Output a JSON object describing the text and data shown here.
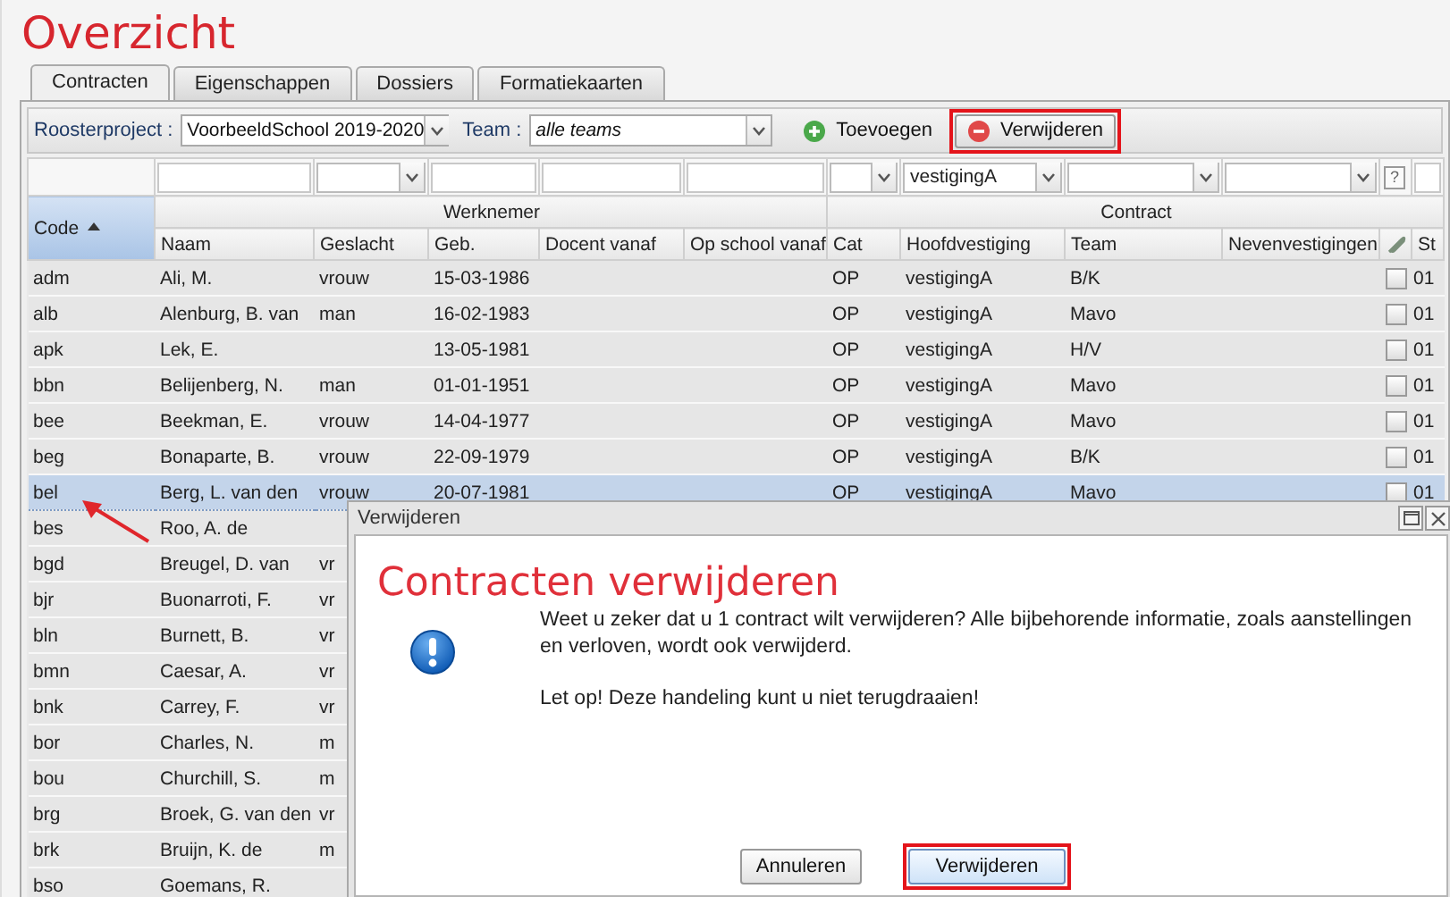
{
  "title": "Overzicht",
  "tabs": [
    {
      "label": "Contracten",
      "selected": true
    },
    {
      "label": "Eigenschappen",
      "selected": false
    },
    {
      "label": "Dossiers",
      "selected": false
    },
    {
      "label": "Formatiekaarten",
      "selected": false
    }
  ],
  "toolbar": {
    "project_label": "Roosterproject :",
    "project_value": "VoorbeeldSchool 2019-2020",
    "team_label": "Team :",
    "team_value": "alle teams",
    "add_button": "Toevoegen",
    "delete_button": {
      "label": "Verwijderen",
      "highlighted": true
    }
  },
  "table": {
    "code_column": {
      "label": "Code",
      "sorted": true
    },
    "groups": [
      {
        "label": "Werknemer",
        "columns": [
          {
            "label": "Naam",
            "filter": {
              "kind": "text"
            }
          },
          {
            "label": "Geslacht",
            "filter": {
              "kind": "select"
            }
          },
          {
            "label": "Geb.",
            "filter": {
              "kind": "text"
            }
          },
          {
            "label": "Docent vanaf",
            "filter": {
              "kind": "text"
            }
          },
          {
            "label": "Op school vanaf",
            "filter": {
              "kind": "text"
            }
          }
        ]
      },
      {
        "label": "Contract",
        "columns": [
          {
            "label": "Cat",
            "filter": {
              "kind": "select"
            }
          },
          {
            "label": "Hoofdvestiging",
            "filter": {
              "kind": "select",
              "value": "vestigingA"
            }
          },
          {
            "label": "Team",
            "filter": {
              "kind": "select"
            }
          },
          {
            "label": "Nevenvestigingen",
            "filter": {
              "kind": "select"
            }
          },
          {
            "kind": "attachment",
            "filter": {
              "kind": "help",
              "label": "?"
            }
          },
          {
            "kind": "text",
            "label": "St",
            "filter": {
              "kind": "text"
            }
          }
        ]
      }
    ],
    "rows": [
      {
        "code": "adm",
        "naam": "Ali, M.",
        "geslacht": "vrouw",
        "geb": "15-03-1986",
        "cat": "OP",
        "hoofdvestiging": "vestigingA",
        "team": "B/K",
        "checked": false,
        "st": "01",
        "selected": false
      },
      {
        "code": "alb",
        "naam": "Alenburg, B. van",
        "geslacht": "man",
        "geb": "16-02-1983",
        "cat": "OP",
        "hoofdvestiging": "vestigingA",
        "team": "Mavo",
        "checked": false,
        "st": "01",
        "selected": false
      },
      {
        "code": "apk",
        "naam": "Lek, E.",
        "geb": "13-05-1981",
        "cat": "OP",
        "hoofdvestiging": "vestigingA",
        "team": "H/V",
        "checked": false,
        "st": "01",
        "selected": false
      },
      {
        "code": "bbn",
        "naam": "Belijenberg, N.",
        "geslacht": "man",
        "geb": "01-01-1951",
        "cat": "OP",
        "hoofdvestiging": "vestigingA",
        "team": "Mavo",
        "checked": false,
        "st": "01",
        "selected": false
      },
      {
        "code": "bee",
        "naam": "Beekman, E.",
        "geslacht": "vrouw",
        "geb": "14-04-1977",
        "cat": "OP",
        "hoofdvestiging": "vestigingA",
        "team": "Mavo",
        "checked": false,
        "st": "01",
        "selected": false
      },
      {
        "code": "beg",
        "naam": "Bonaparte, B.",
        "geslacht": "vrouw",
        "geb": "22-09-1979",
        "cat": "OP",
        "hoofdvestiging": "vestigingA",
        "team": "B/K",
        "checked": false,
        "st": "01",
        "selected": false
      },
      {
        "code": "bel",
        "naam": "Berg, L. van den",
        "geslacht": "vrouw",
        "geb": "20-07-1981",
        "cat": "OP",
        "hoofdvestiging": "vestigingA",
        "team": "Mavo",
        "checked": false,
        "st": "01",
        "selected": true
      },
      {
        "code": "bes",
        "naam": "Roo, A. de",
        "selected": false
      },
      {
        "code": "bgd",
        "naam": "Breugel, D. van",
        "geslacht": "vr",
        "selected": false
      },
      {
        "code": "bjr",
        "naam": "Buonarroti, F.",
        "geslacht": "vr",
        "selected": false
      },
      {
        "code": "bln",
        "naam": "Burnett, B.",
        "geslacht": "vr",
        "selected": false
      },
      {
        "code": "bmn",
        "naam": "Caesar, A.",
        "geslacht": "vr",
        "selected": false
      },
      {
        "code": "bnk",
        "naam": "Carrey, F.",
        "geslacht": "vr",
        "selected": false
      },
      {
        "code": "bor",
        "naam": "Charles, N.",
        "geslacht": "m",
        "selected": false
      },
      {
        "code": "bou",
        "naam": "Churchill, S.",
        "geslacht": "m",
        "selected": false
      },
      {
        "code": "brg",
        "naam": "Broek, G. van den",
        "geslacht": "vr",
        "selected": false
      },
      {
        "code": "brk",
        "naam": "Bruijn, K. de",
        "geslacht": "m",
        "selected": false
      },
      {
        "code": "bso",
        "naam": "Goemans, R.",
        "selected": false
      }
    ]
  },
  "dialog": {
    "title": "Verwijderen",
    "heading": "Contracten verwijderen",
    "message": "Weet u zeker dat u 1 contract wilt verwijderen? Alle bijbehorende informatie, zoals aanstellingen en verloven, wordt ook verwijderd.",
    "warning": "Let op! Deze handeling kunt u niet terugdraaien!",
    "buttons": [
      {
        "label": "Annuleren",
        "highlighted": false
      },
      {
        "label": "Verwijderen",
        "highlighted": true
      }
    ]
  }
}
